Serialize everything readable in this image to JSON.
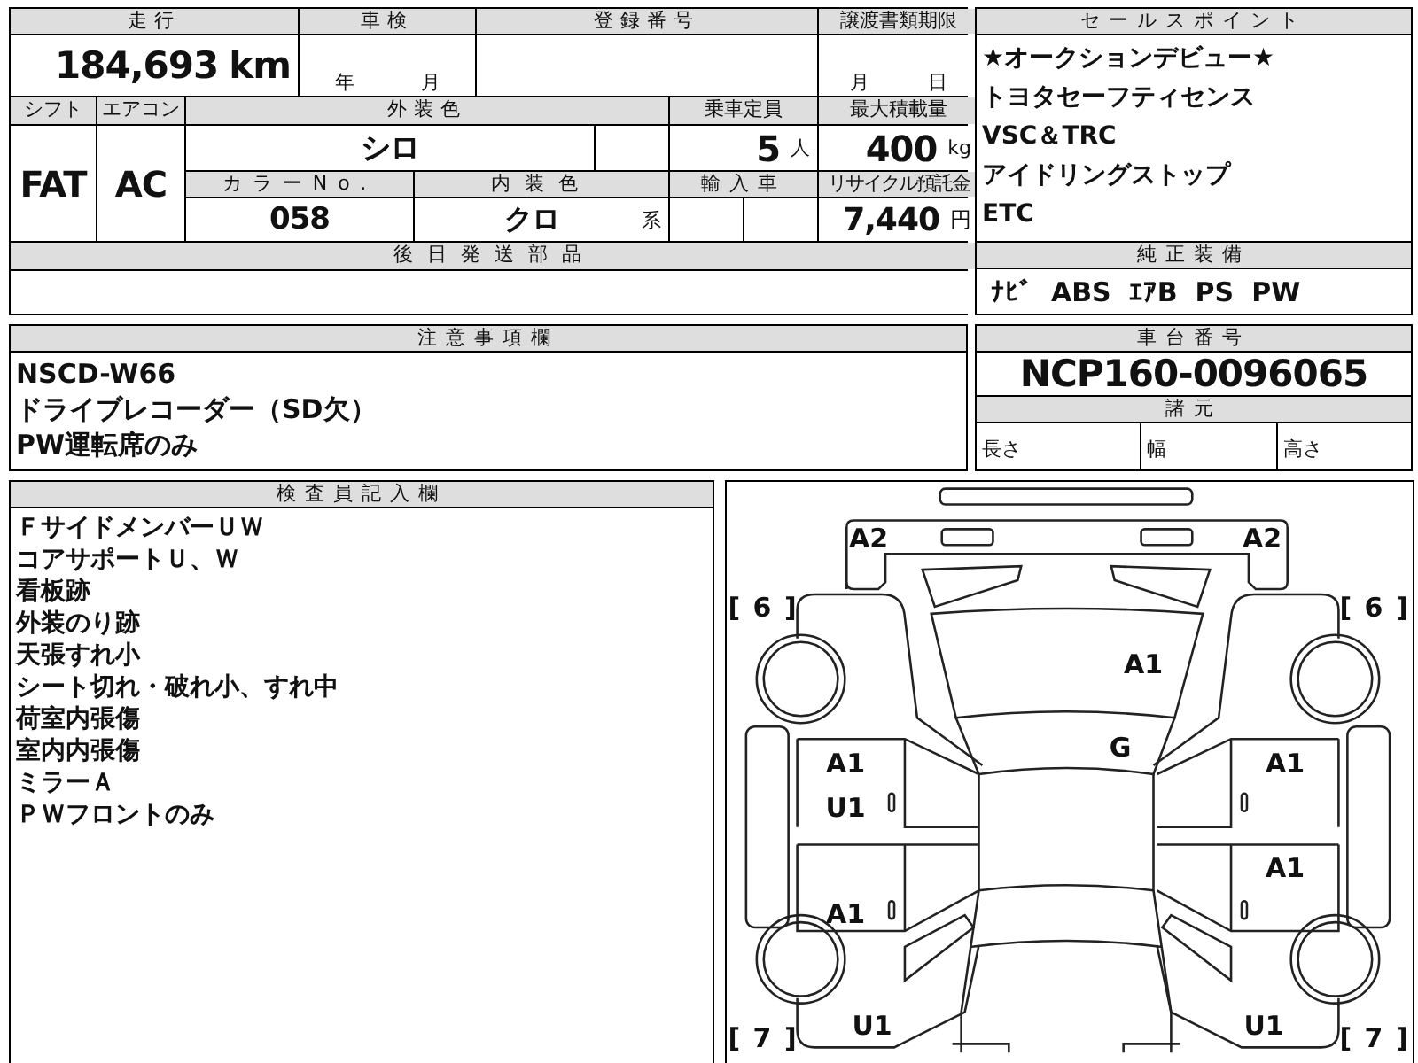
{
  "mileage": {
    "label": "走行",
    "value": "184,693",
    "unit": "km"
  },
  "inspection": {
    "label": "車検",
    "year_unit": "年",
    "month_unit": "月"
  },
  "registration": {
    "label": "登録番号"
  },
  "transfer_deadline": {
    "label": "譲渡書類期限",
    "month_unit": "月",
    "day_unit": "日"
  },
  "shift": {
    "label": "シフト",
    "value": "FAT"
  },
  "aircon": {
    "label": "エアコン",
    "value": "AC"
  },
  "exterior_color": {
    "label": "外装色",
    "value": "シロ"
  },
  "capacity": {
    "label": "乗車定員",
    "value": "5",
    "unit": "人"
  },
  "max_load": {
    "label": "最大積載量",
    "value": "400",
    "unit": "kg"
  },
  "color_no": {
    "label": "カラーNo.",
    "value": "058"
  },
  "interior_color": {
    "label": "内装色",
    "value": "クロ",
    "unit": "系"
  },
  "import": {
    "label": "輸入車"
  },
  "recycle_fee": {
    "label": "リサイクル預託金",
    "value": "7,440",
    "unit": "円"
  },
  "later_parts": {
    "label": "後日発送部品"
  },
  "sale_points": {
    "label": "セールスポイント",
    "lines": [
      "★オークションデビュー★",
      "トヨタセーフティセンス",
      "VSC＆TRC",
      "アイドリングストップ",
      "ETC"
    ]
  },
  "equipment": {
    "label": "純正装備",
    "items": [
      "ﾅﾋﾞ",
      "ABS",
      "ｴｱB",
      "PS",
      "PW"
    ]
  },
  "chassis": {
    "label": "車台番号",
    "value": "NCP160-0096065"
  },
  "specs": {
    "label": "諸元",
    "columns": [
      "長さ",
      "幅",
      "高さ"
    ]
  },
  "notes": {
    "label": "注意事項欄",
    "lines": [
      "NSCD-W66",
      "ドライブレコーダー（SD欠）",
      "PW運転席のみ"
    ]
  },
  "inspector": {
    "label": "検査員記入欄",
    "lines": [
      "ＦサイドメンバーＵＷ",
      "コアサポートＵ、Ｗ",
      "看板跡",
      "外装のり跡",
      "天張すれ小",
      "シート切れ・破れ小、すれ中",
      "荷室内張傷",
      "室内内張傷",
      "ミラーＡ",
      "ＰＷフロントのみ"
    ]
  },
  "diagram": {
    "front_bumper_left": [
      "A2"
    ],
    "front_bumper_right": [
      "A2"
    ],
    "front_fender_left": [
      "[ 6 ]"
    ],
    "front_fender_right": [
      "[ 6 ]"
    ],
    "hood": [
      "A1"
    ],
    "windshield": [
      "G"
    ],
    "front_door_left": [
      "A1",
      "U1"
    ],
    "front_door_right": [
      "A1"
    ],
    "rear_door_right": [
      "A1"
    ],
    "rear_door_left": [
      "A1"
    ],
    "rear_quarter_left": [
      "U1"
    ],
    "rear_quarter_right": [
      "U1"
    ],
    "rear_fender_left": [
      "[ 7 ]"
    ],
    "rear_fender_right": [
      "[ 7 ]"
    ]
  }
}
